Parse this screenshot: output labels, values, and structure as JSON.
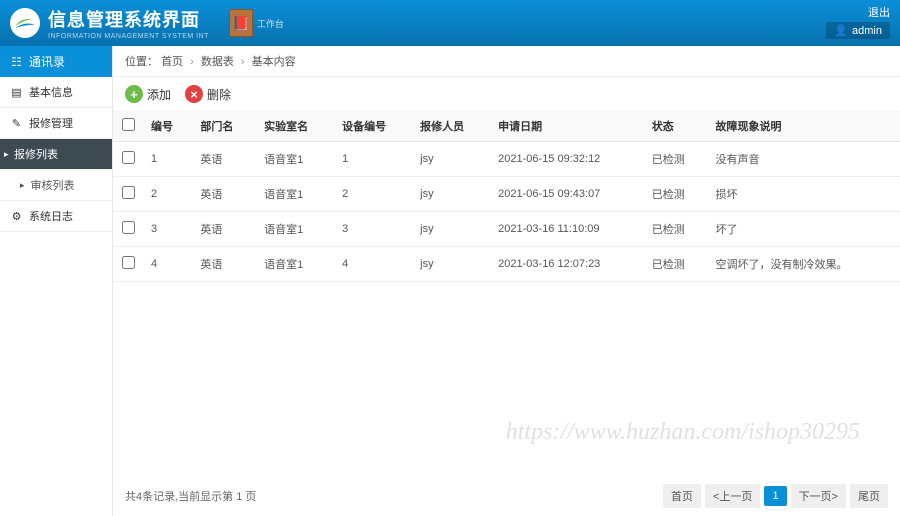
{
  "header": {
    "title": "信息管理系统界面",
    "subtitle": "INFORMATION MANAGEMENT SYSTEM INT",
    "tool_label": "工作台",
    "logout": "退出",
    "user": "admin"
  },
  "sidebar": {
    "header": "通讯录",
    "items": [
      {
        "label": "基本信息",
        "type": "item"
      },
      {
        "label": "报修管理",
        "type": "item"
      },
      {
        "label": "报修列表",
        "type": "active"
      },
      {
        "label": "审核列表",
        "type": "sub"
      },
      {
        "label": "系统日志",
        "type": "item"
      }
    ]
  },
  "breadcrumb": {
    "prefix": "位置：",
    "parts": [
      "首页",
      "数据表",
      "基本内容"
    ]
  },
  "toolbar": {
    "add": "添加",
    "del": "删除"
  },
  "table": {
    "columns": [
      "编号",
      "部门名",
      "实验室名",
      "设备编号",
      "报修人员",
      "申请日期",
      "状态",
      "故障现象说明"
    ],
    "rows": [
      {
        "id": "1",
        "dept": "英语",
        "lab": "语音室1",
        "dev": "1",
        "person": "jsy",
        "date": "2021-06-15 09:32:12",
        "status": "已检测",
        "desc": "没有声音"
      },
      {
        "id": "2",
        "dept": "英语",
        "lab": "语音室1",
        "dev": "2",
        "person": "jsy",
        "date": "2021-06-15 09:43:07",
        "status": "已检测",
        "desc": "损坏"
      },
      {
        "id": "3",
        "dept": "英语",
        "lab": "语音室1",
        "dev": "3",
        "person": "jsy",
        "date": "2021-03-16 11:10:09",
        "status": "已检测",
        "desc": "坏了"
      },
      {
        "id": "4",
        "dept": "英语",
        "lab": "语音室1",
        "dev": "4",
        "person": "jsy",
        "date": "2021-03-16 12:07:23",
        "status": "已检测",
        "desc": "空调坏了，没有制冷效果。"
      }
    ]
  },
  "footer": {
    "info": "共4条记录,当前显示第 1 页",
    "pages": {
      "first": "首页",
      "prev": "<上一页",
      "current": "1",
      "next": "下一页>",
      "last": "尾页"
    }
  },
  "watermark": "https://www.huzhan.com/ishop30295"
}
